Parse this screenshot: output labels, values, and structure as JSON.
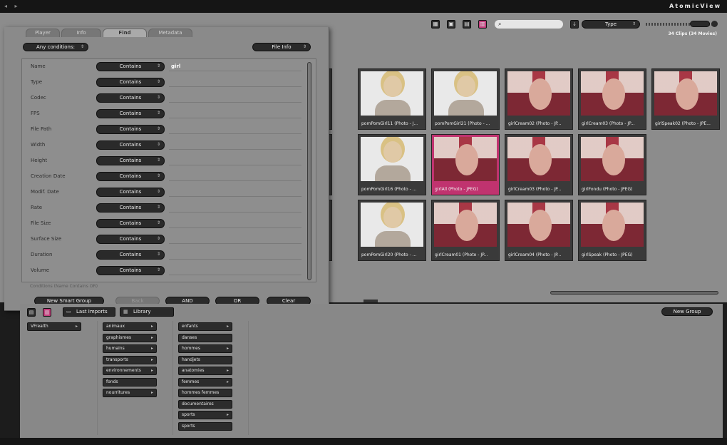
{
  "app": {
    "title": "AtomicView",
    "titlebar_icons": "◂ ▸"
  },
  "search_panel": {
    "tabs": [
      "Player",
      "Info",
      "Find",
      "Metadata"
    ],
    "active_tab": "Find",
    "match_mode": "Any conditions:",
    "info_select": "File Info",
    "conditions": [
      {
        "label": "Name",
        "op": "Contains",
        "value": "girl"
      },
      {
        "label": "Type",
        "op": "Contains",
        "value": ""
      },
      {
        "label": "Codec",
        "op": "Contains",
        "value": ""
      },
      {
        "label": "FPS",
        "op": "Contains",
        "value": ""
      },
      {
        "label": "File Path",
        "op": "Contains",
        "value": ""
      },
      {
        "label": "Width",
        "op": "Contains",
        "value": ""
      },
      {
        "label": "Height",
        "op": "Contains",
        "value": ""
      },
      {
        "label": "Creation Date",
        "op": "Contains",
        "value": ""
      },
      {
        "label": "Modif. Date",
        "op": "Contains",
        "value": ""
      },
      {
        "label": "Rate",
        "op": "Contains",
        "value": ""
      },
      {
        "label": "File Size",
        "op": "Contains",
        "value": ""
      },
      {
        "label": "Surface Size",
        "op": "Contains",
        "value": ""
      },
      {
        "label": "Duration",
        "op": "Contains",
        "value": ""
      },
      {
        "label": "Volume",
        "op": "Contains",
        "value": ""
      }
    ],
    "note": "Conditions (Name Contains OR)",
    "buttons": {
      "new_smart_group": "New Smart Group",
      "back": "Back",
      "and": "AND",
      "or": "OR",
      "clear": "Clear"
    }
  },
  "viewer": {
    "toolbar_icons": [
      "▦",
      "▣",
      "▤",
      "▥"
    ],
    "search_placeholder": "",
    "search_icon": "⌕",
    "sort_label": "Type",
    "clip_count": "34 Clips (34 Movies)",
    "thumbnails": [
      {
        "caption": "",
        "style": "dark"
      },
      {
        "caption": "pomPomGirl11 (Photo - J...",
        "style": "portrait"
      },
      {
        "caption": "pomPomGirl21 (Photo - ...",
        "style": "portrait"
      },
      {
        "caption": "girlCream02 (Photo - JP...",
        "style": "red"
      },
      {
        "caption": "girlCream03 (Photo - JP...",
        "style": "red"
      },
      {
        "caption": "girlSpeak02 (Photo - JPE...",
        "style": "red"
      },
      {
        "caption": "",
        "style": "portrait"
      },
      {
        "caption": "pomPomGirl16 (Photo - ...",
        "style": "portrait"
      },
      {
        "caption": "girlAll (Photo - JPEG)",
        "style": "red"
      },
      {
        "caption": "girlCream03 (Photo - JP...",
        "style": "red"
      },
      {
        "caption": "girlFondu (Photo - JPEG)",
        "style": "red"
      },
      {
        "caption": "",
        "style": "portrait"
      },
      {
        "caption": "pomPomGirl20 (Photo - ...",
        "style": "portrait"
      },
      {
        "caption": "girlCream01 (Photo - JP...",
        "style": "red"
      },
      {
        "caption": "girlCream04 (Photo - JP...",
        "style": "red"
      },
      {
        "caption": "girlSpeak (Photo - JPEG)",
        "style": "red"
      }
    ]
  },
  "library": {
    "last_imports": "Last Imports",
    "library": "Library",
    "new_group": "New Group",
    "col1": [
      "VFrealth"
    ],
    "col2": [
      "animaux",
      "graphismes",
      "humains",
      "transports",
      "environnements",
      "fonds",
      "nourritures"
    ],
    "col3": [
      "enfants",
      "danses",
      "hommes",
      "handjets",
      "anatomies",
      "femmes",
      "hommes femmes",
      "documentaires",
      "sports",
      "sports"
    ]
  }
}
